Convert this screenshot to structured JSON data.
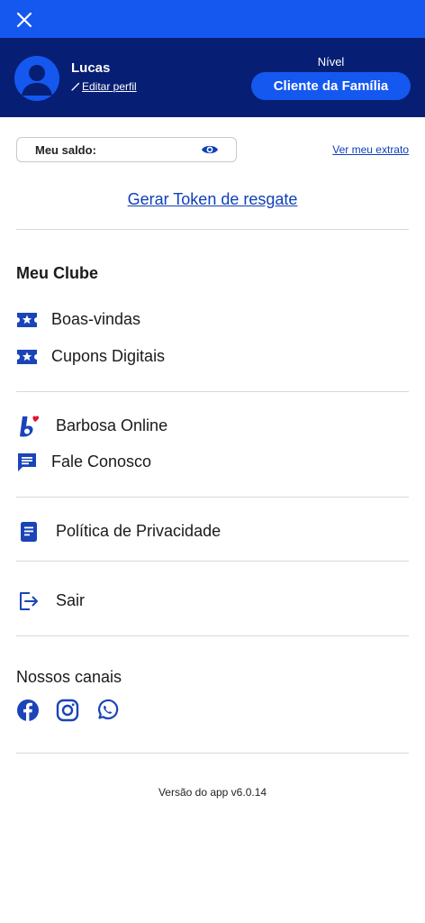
{
  "header": {
    "close_icon": "close-icon",
    "user_name": "Lucas",
    "edit_profile": "Editar perfil",
    "level_label": "Nível",
    "level_value": "Cliente da Família"
  },
  "balance": {
    "label": "Meu saldo:",
    "toggle_icon": "eye-icon",
    "statement_link": "Ver meu extrato"
  },
  "token_link": "Gerar Token de resgate",
  "club": {
    "title": "Meu Clube",
    "items": [
      {
        "label": "Boas-vindas",
        "icon": "ticket-star-icon"
      },
      {
        "label": "Cupons Digitais",
        "icon": "ticket-star-icon"
      }
    ]
  },
  "services": {
    "items": [
      {
        "label": "Barbosa Online",
        "icon": "barbosa-logo-icon"
      },
      {
        "label": "Fale Conosco",
        "icon": "chat-icon"
      }
    ]
  },
  "privacy": {
    "label": "Política de Privacidade",
    "icon": "document-icon"
  },
  "logout": {
    "label": "Sair",
    "icon": "logout-icon"
  },
  "channels": {
    "title": "Nossos canais",
    "icons": [
      "facebook-icon",
      "instagram-icon",
      "whatsapp-icon"
    ]
  },
  "version": "Versão do app v6.0.14",
  "colors": {
    "primary": "#1558f0",
    "dark": "#061e73",
    "link": "#0f3fb8",
    "icon": "#1a44b8"
  }
}
